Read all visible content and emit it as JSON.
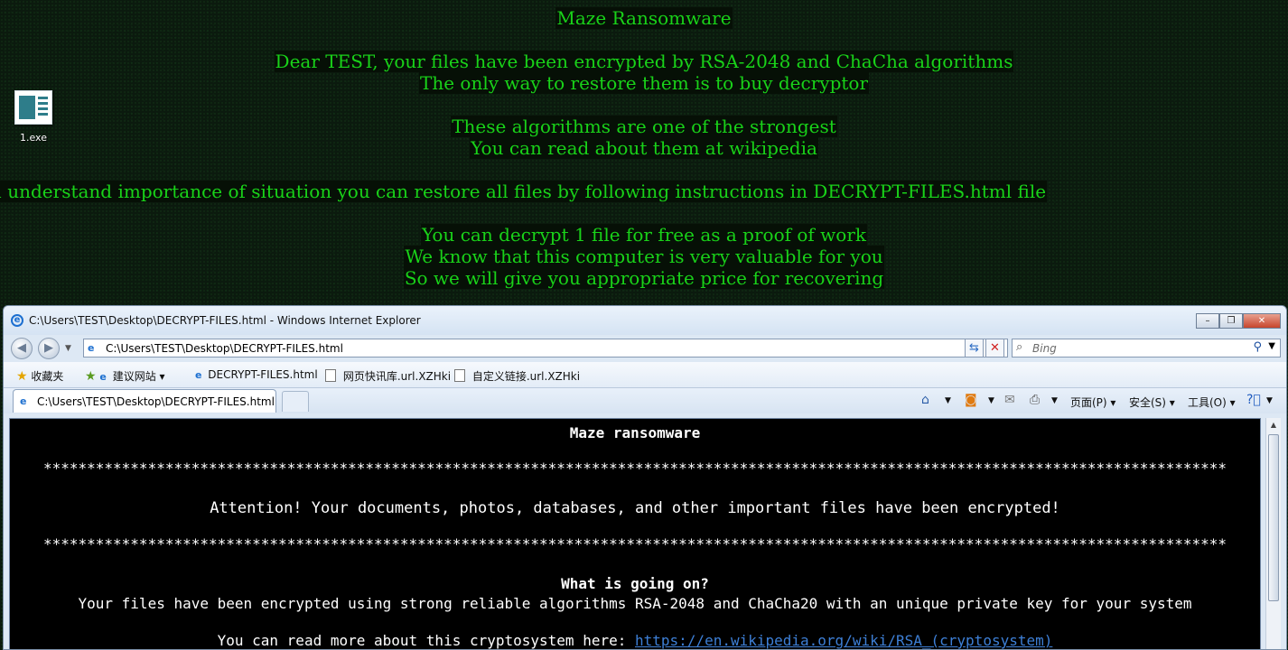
{
  "wallpaper": {
    "lines": [
      "Maze Ransomware",
      "Dear TEST, your files have been encrypted by RSA-2048 and ChaCha algorithms",
      "The only way to restore them is to buy decryptor",
      "These algorithms are one of the strongest",
      "You can read about them at wikipedia",
      "u understand importance of situation you can restore all files by following instructions in DECRYPT-FILES.html file",
      "You can decrypt 1 file for free as a proof of work",
      "We know that this computer is very valuable for you",
      "So we will give you appropriate price for recovering"
    ],
    "text_color": "#19d219"
  },
  "desktop_icon": {
    "label": "1.exe"
  },
  "window": {
    "title": "C:\\Users\\TEST\\Desktop\\DECRYPT-FILES.html - Windows Internet Explorer",
    "minimize": "–",
    "restore": "❐",
    "close": "✕"
  },
  "address_bar": {
    "value": "C:\\Users\\TEST\\Desktop\\DECRYPT-FILES.html"
  },
  "search_box": {
    "placeholder": "Bing"
  },
  "favorites_bar": {
    "favorites_label": "收藏夹",
    "items": [
      "建议网站 ▾",
      "DECRYPT-FILES.html",
      "网页快讯库.url.XZHki",
      "自定义链接.url.XZHki"
    ]
  },
  "tab": {
    "label": "C:\\Users\\TEST\\Desktop\\DECRYPT-FILES.html"
  },
  "command_bar": {
    "page": "页面(P) ▾",
    "safety": "安全(S) ▾",
    "tools": "工具(O) ▾"
  },
  "page": {
    "heading": "Maze ransomware",
    "stars": "****************************************************************************************************************************************",
    "attention": "Attention! Your documents, photos, databases, and other important files have been encrypted!",
    "what_heading": "What is going on?",
    "what_text": "Your files have been encrypted using strong reliable algorithms RSA-2048 and ChaCha20 with an unique private key for your system",
    "read_more": "You can read more about this cryptosystem here:",
    "link": "https://en.wikipedia.org/wiki/RSA_(cryptosystem)"
  }
}
